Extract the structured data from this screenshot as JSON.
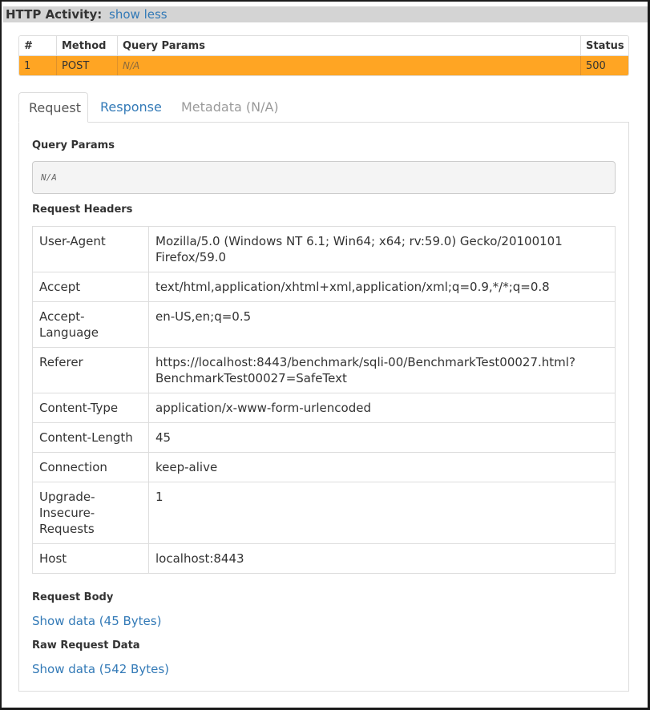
{
  "header": {
    "title": "HTTP Activity:",
    "toggle_link": "show less"
  },
  "activity_table": {
    "columns": [
      "#",
      "Method",
      "Query Params",
      "Status"
    ],
    "rows": [
      {
        "num": "1",
        "method": "POST",
        "query_params": "N/A",
        "status": "500"
      }
    ],
    "highlight_color": "#ffa523"
  },
  "tabs": [
    {
      "label": "Request",
      "active": true
    },
    {
      "label": "Response",
      "active": false
    },
    {
      "label": "Metadata (N/A)",
      "active": false,
      "disabled": true
    }
  ],
  "request": {
    "query_params_title": "Query Params",
    "query_params_value": "N/A",
    "headers_title": "Request Headers",
    "headers": [
      {
        "key": "User-Agent",
        "value": "Mozilla/5.0 (Windows NT 6.1; Win64; x64; rv:59.0) Gecko/20100101 Firefox/59.0"
      },
      {
        "key": "Accept",
        "value": "text/html,application/xhtml+xml,application/xml;q=0.9,*/*;q=0.8"
      },
      {
        "key": "Accept-Language",
        "value": "en-US,en;q=0.5"
      },
      {
        "key": "Referer",
        "value": "https://localhost:8443/benchmark/sqli-00/BenchmarkTest00027.html?BenchmarkTest00027=SafeText"
      },
      {
        "key": "Content-Type",
        "value": "application/x-www-form-urlencoded"
      },
      {
        "key": "Content-Length",
        "value": "45"
      },
      {
        "key": "Connection",
        "value": "keep-alive"
      },
      {
        "key": "Upgrade-Insecure-Requests",
        "value": "1"
      },
      {
        "key": "Host",
        "value": "localhost:8443"
      }
    ],
    "body_title": "Request Body",
    "body_link": "Show data (45 Bytes)",
    "raw_title": "Raw Request Data",
    "raw_link": "Show data (542 Bytes)"
  },
  "colors": {
    "link": "#337ab7",
    "header_bar": "#d4d4d4"
  }
}
